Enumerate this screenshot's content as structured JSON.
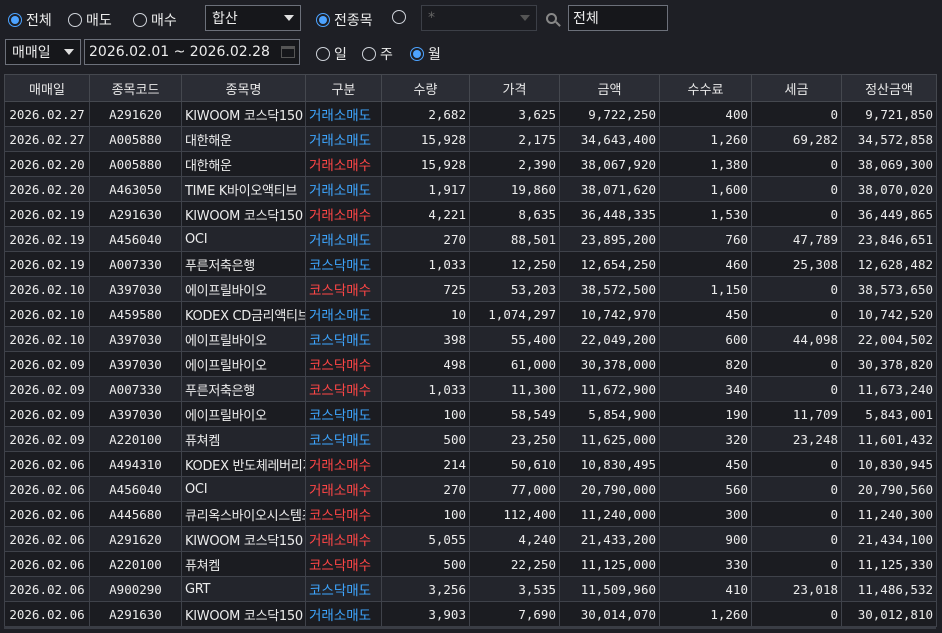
{
  "filters": {
    "trade_type_options": [
      {
        "label": "전체",
        "selected": true
      },
      {
        "label": "매도",
        "selected": false
      },
      {
        "label": "매수",
        "selected": false
      }
    ],
    "market_combo": "합산",
    "stock_scope_options": [
      {
        "label": "전종목",
        "selected": true
      },
      {
        "label": "",
        "selected": false
      }
    ],
    "stock_code_placeholder": "*",
    "stock_name_value": "전체",
    "date_type_combo": "매매일",
    "date_range": "2026.02.01 ~ 2026.02.28",
    "period_options": [
      {
        "label": "일",
        "selected": false
      },
      {
        "label": "주",
        "selected": false
      },
      {
        "label": "월",
        "selected": true
      }
    ]
  },
  "table": {
    "columns": [
      "매매일",
      "종목코드",
      "종목명",
      "구분",
      "수량",
      "가격",
      "금액",
      "수수료",
      "세금",
      "정산금액"
    ],
    "rows": [
      {
        "date": "2026.02.27",
        "code": "A291620",
        "name": "KIWOOM 코스닥150",
        "type": "거래소매도",
        "side": "sell",
        "qty": "2,682",
        "price": "3,625",
        "amount": "9,722,250",
        "fee": "400",
        "tax": "0",
        "settle": "9,721,850"
      },
      {
        "date": "2026.02.27",
        "code": "A005880",
        "name": "대한해운",
        "type": "거래소매도",
        "side": "sell",
        "qty": "15,928",
        "price": "2,175",
        "amount": "34,643,400",
        "fee": "1,260",
        "tax": "69,282",
        "settle": "34,572,858"
      },
      {
        "date": "2026.02.20",
        "code": "A005880",
        "name": "대한해운",
        "type": "거래소매수",
        "side": "buy",
        "qty": "15,928",
        "price": "2,390",
        "amount": "38,067,920",
        "fee": "1,380",
        "tax": "0",
        "settle": "38,069,300"
      },
      {
        "date": "2026.02.20",
        "code": "A463050",
        "name": "TIME K바이오액티브",
        "type": "거래소매도",
        "side": "sell",
        "qty": "1,917",
        "price": "19,860",
        "amount": "38,071,620",
        "fee": "1,600",
        "tax": "0",
        "settle": "38,070,020"
      },
      {
        "date": "2026.02.19",
        "code": "A291630",
        "name": "KIWOOM 코스닥150",
        "type": "거래소매수",
        "side": "buy",
        "qty": "4,221",
        "price": "8,635",
        "amount": "36,448,335",
        "fee": "1,530",
        "tax": "0",
        "settle": "36,449,865"
      },
      {
        "date": "2026.02.19",
        "code": "A456040",
        "name": "OCI",
        "type": "거래소매도",
        "side": "sell",
        "qty": "270",
        "price": "88,501",
        "amount": "23,895,200",
        "fee": "760",
        "tax": "47,789",
        "settle": "23,846,651"
      },
      {
        "date": "2026.02.19",
        "code": "A007330",
        "name": "푸른저축은행",
        "type": "코스닥매도",
        "side": "sell",
        "qty": "1,033",
        "price": "12,250",
        "amount": "12,654,250",
        "fee": "460",
        "tax": "25,308",
        "settle": "12,628,482"
      },
      {
        "date": "2026.02.10",
        "code": "A397030",
        "name": "에이프릴바이오",
        "type": "코스닥매수",
        "side": "buy",
        "qty": "725",
        "price": "53,203",
        "amount": "38,572,500",
        "fee": "1,150",
        "tax": "0",
        "settle": "38,573,650"
      },
      {
        "date": "2026.02.10",
        "code": "A459580",
        "name": "KODEX CD금리액티브",
        "type": "거래소매도",
        "side": "sell",
        "qty": "10",
        "price": "1,074,297",
        "amount": "10,742,970",
        "fee": "450",
        "tax": "0",
        "settle": "10,742,520"
      },
      {
        "date": "2026.02.10",
        "code": "A397030",
        "name": "에이프릴바이오",
        "type": "코스닥매도",
        "side": "sell",
        "qty": "398",
        "price": "55,400",
        "amount": "22,049,200",
        "fee": "600",
        "tax": "44,098",
        "settle": "22,004,502"
      },
      {
        "date": "2026.02.09",
        "code": "A397030",
        "name": "에이프릴바이오",
        "type": "코스닥매수",
        "side": "buy",
        "qty": "498",
        "price": "61,000",
        "amount": "30,378,000",
        "fee": "820",
        "tax": "0",
        "settle": "30,378,820"
      },
      {
        "date": "2026.02.09",
        "code": "A007330",
        "name": "푸른저축은행",
        "type": "코스닥매수",
        "side": "buy",
        "qty": "1,033",
        "price": "11,300",
        "amount": "11,672,900",
        "fee": "340",
        "tax": "0",
        "settle": "11,673,240"
      },
      {
        "date": "2026.02.09",
        "code": "A397030",
        "name": "에이프릴바이오",
        "type": "코스닥매도",
        "side": "sell",
        "qty": "100",
        "price": "58,549",
        "amount": "5,854,900",
        "fee": "190",
        "tax": "11,709",
        "settle": "5,843,001"
      },
      {
        "date": "2026.02.09",
        "code": "A220100",
        "name": "퓨쳐켐",
        "type": "코스닥매도",
        "side": "sell",
        "qty": "500",
        "price": "23,250",
        "amount": "11,625,000",
        "fee": "320",
        "tax": "23,248",
        "settle": "11,601,432"
      },
      {
        "date": "2026.02.06",
        "code": "A494310",
        "name": "KODEX 반도체레버리지",
        "type": "거래소매수",
        "side": "buy",
        "qty": "214",
        "price": "50,610",
        "amount": "10,830,495",
        "fee": "450",
        "tax": "0",
        "settle": "10,830,945"
      },
      {
        "date": "2026.02.06",
        "code": "A456040",
        "name": "OCI",
        "type": "거래소매수",
        "side": "buy",
        "qty": "270",
        "price": "77,000",
        "amount": "20,790,000",
        "fee": "560",
        "tax": "0",
        "settle": "20,790,560"
      },
      {
        "date": "2026.02.06",
        "code": "A445680",
        "name": "큐리옥스바이오시스템즈",
        "type": "코스닥매수",
        "side": "buy",
        "qty": "100",
        "price": "112,400",
        "amount": "11,240,000",
        "fee": "300",
        "tax": "0",
        "settle": "11,240,300"
      },
      {
        "date": "2026.02.06",
        "code": "A291620",
        "name": "KIWOOM 코스닥150",
        "type": "거래소매수",
        "side": "buy",
        "qty": "5,055",
        "price": "4,240",
        "amount": "21,433,200",
        "fee": "900",
        "tax": "0",
        "settle": "21,434,100"
      },
      {
        "date": "2026.02.06",
        "code": "A220100",
        "name": "퓨쳐켐",
        "type": "코스닥매수",
        "side": "buy",
        "qty": "500",
        "price": "22,250",
        "amount": "11,125,000",
        "fee": "330",
        "tax": "0",
        "settle": "11,125,330"
      },
      {
        "date": "2026.02.06",
        "code": "A900290",
        "name": "GRT",
        "type": "코스닥매도",
        "side": "sell",
        "qty": "3,256",
        "price": "3,535",
        "amount": "11,509,960",
        "fee": "410",
        "tax": "23,018",
        "settle": "11,486,532"
      },
      {
        "date": "2026.02.06",
        "code": "A291630",
        "name": "KIWOOM 코스닥150",
        "type": "거래소매도",
        "side": "sell",
        "qty": "3,903",
        "price": "7,690",
        "amount": "30,014,070",
        "fee": "1,260",
        "tax": "0",
        "settle": "30,012,810"
      }
    ]
  },
  "colors": {
    "buy": "#ff4646",
    "sell": "#3ea6ff",
    "radio_selected": "#4da3ff",
    "background": "#1e1f25",
    "header_bg": "#2b2d35"
  }
}
